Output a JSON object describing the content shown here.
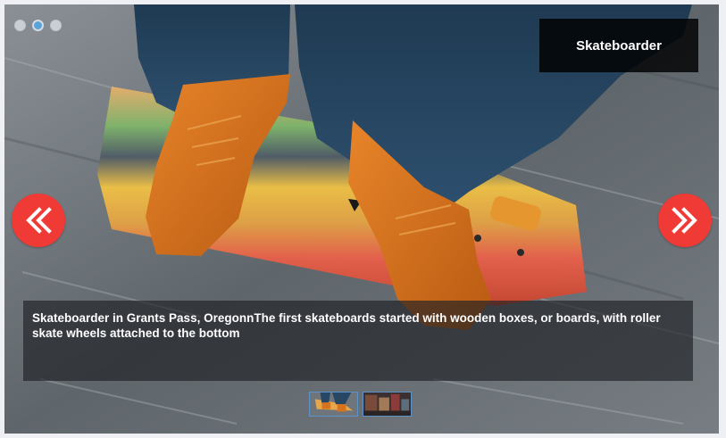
{
  "slider": {
    "title": "Skateboarder",
    "caption": "Skateboarder in Grants Pass, OregonnThe first skateboards started with wooden boxes, or boards, with roller skate wheels attached to the bottom",
    "active_slide": 2,
    "dots": [
      {
        "state": "inactive"
      },
      {
        "state": "active"
      },
      {
        "state": "inactive"
      }
    ],
    "nav": {
      "prev_icon": "double-chevron-left-icon",
      "next_icon": "double-chevron-right-icon"
    },
    "thumbnails": [
      {
        "image": "skateboard-thumbnail"
      },
      {
        "image": "street-thumbnail"
      }
    ],
    "colors": {
      "nav_button": "#f03a35",
      "active_dot": "#5aa3d9",
      "thumb_border": "#5d93c7"
    }
  }
}
